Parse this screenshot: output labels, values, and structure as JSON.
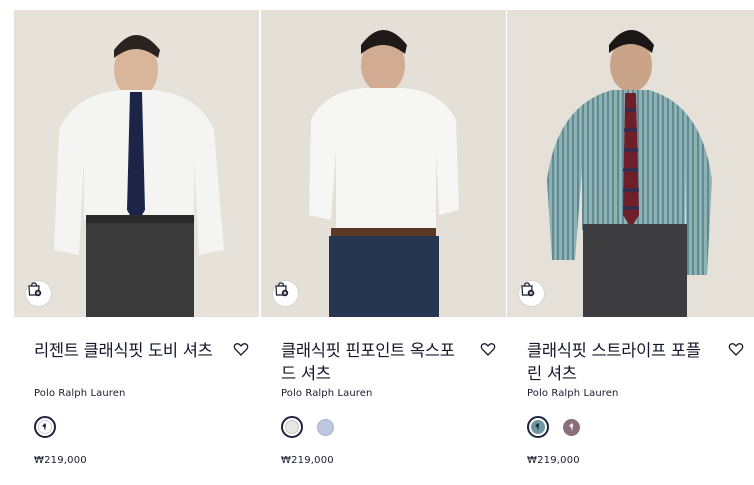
{
  "products": [
    {
      "name": "리젠트 클래식핏 도비 셔츠",
      "brand": "Polo Ralph Lauren",
      "price": "₩219,000",
      "shirt_color": "#f4f4f2",
      "tie_color": "#1c2547",
      "pants_color": "#3a3a3a",
      "swatches": [
        {
          "color": "#ffffff",
          "logo": "#1c2547",
          "selected": true
        }
      ]
    },
    {
      "name": "클래식핏 핀포인트 옥스포드 셔츠",
      "brand": "Polo Ralph Lauren",
      "price": "₩219,000",
      "shirt_color": "#f6f6f4",
      "tie_color": "",
      "pants_color": "#263650",
      "swatches": [
        {
          "color": "#e8e8e3",
          "logo": "",
          "selected": true
        },
        {
          "color": "#bcc8e0",
          "logo": "",
          "selected": false
        }
      ]
    },
    {
      "name": "클래식핏 스트라이프 포플린 셔츠",
      "brand": "Polo Ralph Lauren",
      "price": "₩219,000",
      "shirt_color": "#7fa4a8",
      "tie_color": "#6e1f2a",
      "pants_color": "#3d3d3f",
      "swatches": [
        {
          "color": "#6f97a0",
          "logo": "#1c2547",
          "selected": true
        },
        {
          "color": "#8a6e7c",
          "logo": "#ffffff",
          "selected": false
        }
      ]
    }
  ],
  "icons": {
    "bag": "add-to-bag-icon",
    "heart": "wishlist-heart-icon",
    "logo": "polo-player-logo-icon"
  }
}
